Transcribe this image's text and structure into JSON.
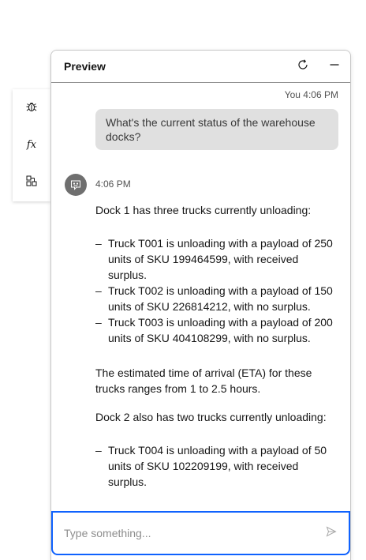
{
  "panel": {
    "title": "Preview",
    "refresh_icon": "refresh-icon",
    "minimize_icon": "minimize-icon"
  },
  "side_toolbar": {
    "items": [
      {
        "icon": "debug-icon"
      },
      {
        "icon": "function-icon",
        "glyph": "fx"
      },
      {
        "icon": "data-structure-icon"
      }
    ]
  },
  "conversation": {
    "user_message": {
      "meta": "You 4:06 PM",
      "text": "What's the current status of the warehouse docks?"
    },
    "bot_message": {
      "avatar_icon": "chat-bot-icon",
      "time": "4:06 PM",
      "intro": "Dock 1 has three trucks currently unloading:",
      "dock1_items": [
        "Truck T001 is unloading with a payload of 250 units of SKU 199464599, with received surplus.",
        "Truck T002 is unloading with a payload of 150 units of SKU 226814212, with no surplus.",
        "Truck T003 is unloading with a payload of 200 units of SKU 404108299, with no surplus."
      ],
      "eta_text": "The estimated time of arrival (ETA) for these trucks ranges from 1 to 2.5 hours.",
      "dock2_intro": "Dock 2 also has two trucks currently unloading:",
      "dock2_items": [
        "Truck T004 is unloading with a payload of 50 units of SKU 102209199, with received surplus."
      ]
    }
  },
  "input": {
    "placeholder": "Type something...",
    "value": "",
    "send_icon": "send-icon"
  },
  "colors": {
    "accent": "#0f62fe",
    "bubble": "#e0e0e0",
    "avatar": "#6f6f6f"
  }
}
